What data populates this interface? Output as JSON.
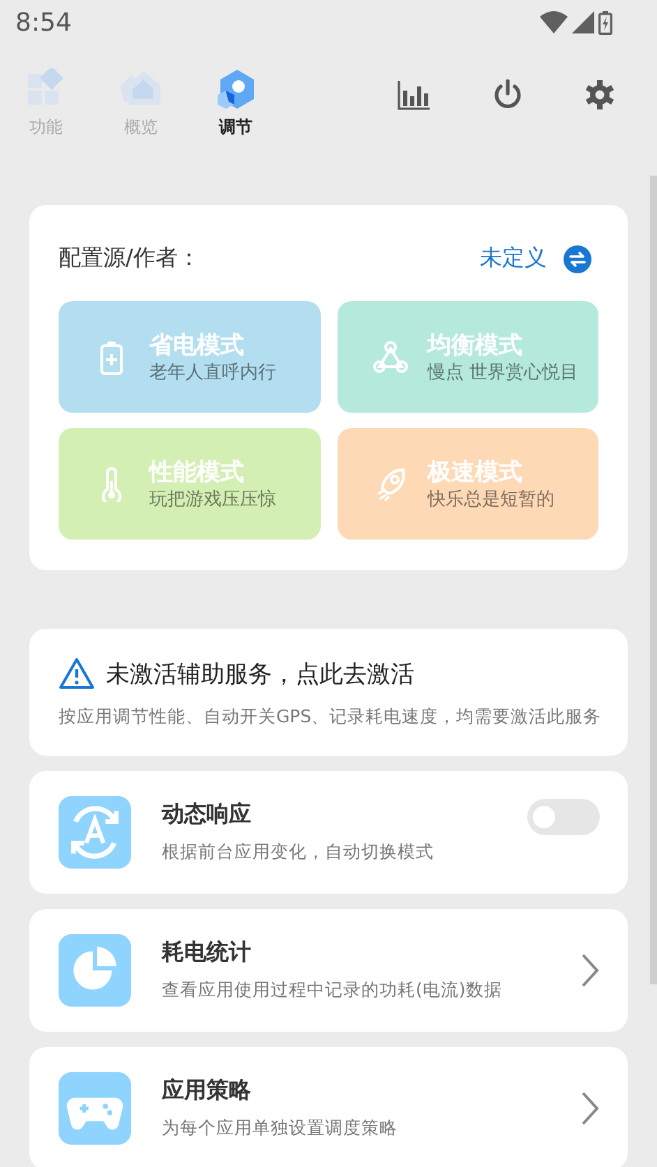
{
  "status_bar": {
    "time": "8:54"
  },
  "tabs": [
    {
      "label": "功能",
      "selected": false
    },
    {
      "label": "概览",
      "selected": false
    },
    {
      "label": "调节",
      "selected": true
    }
  ],
  "profile": {
    "label": "配置源/作者：",
    "value": "未定义"
  },
  "modes": [
    {
      "kind": "battery",
      "title": "省电模式",
      "subtitle": "老年人直呼内行",
      "color": "#b3def0"
    },
    {
      "kind": "network",
      "title": "均衡模式",
      "subtitle": "慢点 世界赏心悦目",
      "color": "#b4e9dc"
    },
    {
      "kind": "thermometer",
      "title": "性能模式",
      "subtitle": "玩把游戏压压惊",
      "color": "#d4efb4"
    },
    {
      "kind": "rocket",
      "title": "极速模式",
      "subtitle": "快乐总是短暂的",
      "color": "#fdd9b6"
    }
  ],
  "notice": {
    "title": "未激活辅助服务，点此去激活",
    "description": "按应用调节性能、自动开关GPS、记录耗电速度，均需要激活此服务"
  },
  "features": [
    {
      "kind": "auto",
      "title": "动态响应",
      "subtitle": "根据前台应用变化，自动切换模式",
      "on": false
    },
    {
      "kind": "pie",
      "title": "耗电统计",
      "subtitle": "查看应用使用过程中记录的功耗(电流)数据"
    },
    {
      "kind": "gamepad",
      "title": "应用策略",
      "subtitle": "为每个应用单独设置调度策略"
    }
  ]
}
